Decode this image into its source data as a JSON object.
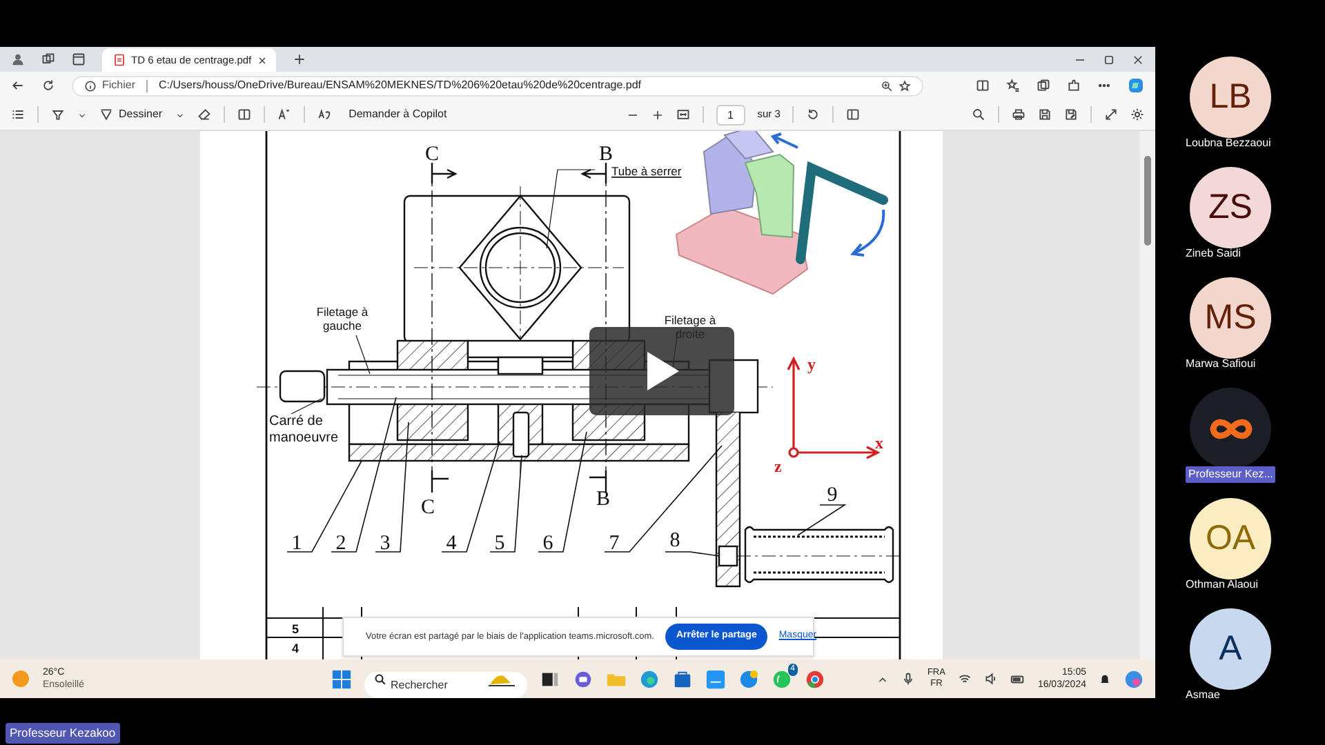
{
  "browser": {
    "tab_title": "TD 6 etau de centrage.pdf",
    "address_label": "Fichier",
    "url": "C:/Users/houss/OneDrive/Bureau/ENSAM%20MEKNES/TD%206%20etau%20de%20centrage.pdf"
  },
  "pdf_toolbar": {
    "draw_label": "Dessiner",
    "copilot_label": "Demander à Copilot",
    "page": "1",
    "page_total": "sur 3"
  },
  "drawing": {
    "section_marks": [
      "C",
      "B",
      "C",
      "B"
    ],
    "callouts": [
      {
        "lines": [
          "Tube à serrer"
        ]
      },
      {
        "lines": [
          "Filetage à",
          "gauche"
        ]
      },
      {
        "lines": [
          "Filetage à",
          "droite"
        ]
      },
      {
        "lines": [
          "Carré de",
          "manoeuvre"
        ]
      }
    ],
    "part_numbers": [
      "1",
      "2",
      "3",
      "4",
      "5",
      "6",
      "7",
      "8",
      "9"
    ],
    "axes": [
      "y",
      "x",
      "z"
    ]
  },
  "parts_table": {
    "rows": [
      "5",
      "4"
    ]
  },
  "share_banner": {
    "text": "Votre écran est partagé par le biais de l'application teams.microsoft.com.",
    "stop_button": "Arrêter le partage",
    "hide_link": "Masquer"
  },
  "taskbar": {
    "temperature": "26°C",
    "weather": "Ensoleillé",
    "search_placeholder": "Rechercher",
    "whatsapp_badge": "4",
    "language": "FRA",
    "layout": "FR",
    "time": "15:05",
    "date": "16/03/2024"
  },
  "presenter_label": "Professeur Kezakoo",
  "participants": [
    {
      "kind": "initials",
      "initials": "LB",
      "name": "Loubna Bezzaoui",
      "color": "#f3d6cc",
      "highlighted": false
    },
    {
      "kind": "initials",
      "initials": "ZS",
      "name": "Zineb Saidi",
      "color": "#f3d8d8",
      "highlighted": false
    },
    {
      "kind": "initials",
      "initials": "MS",
      "name": "Marwa Safioui",
      "color": "#f3d6cc",
      "highlighted": false
    },
    {
      "kind": "logo",
      "name": "Professeur Kez...",
      "color": "#1b1e26",
      "highlighted": true
    },
    {
      "kind": "initials",
      "initials": "OA",
      "name": "Othman Alaoui",
      "color": "#fbecc2",
      "highlighted": false
    },
    {
      "kind": "initials",
      "initials": "A",
      "name": "Asmae",
      "color": "#c8d8ee",
      "highlighted": false
    }
  ]
}
